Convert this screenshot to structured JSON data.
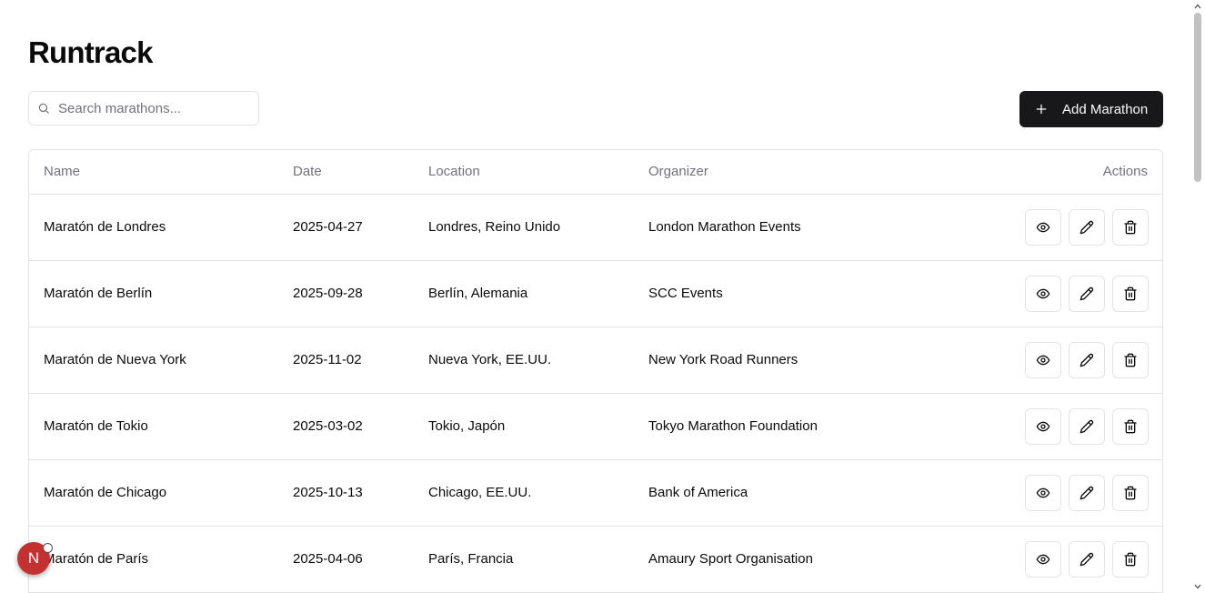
{
  "app": {
    "title": "Runtrack"
  },
  "search": {
    "placeholder": "Search marathons...",
    "value": ""
  },
  "toolbar": {
    "add_label": "Add Marathon"
  },
  "table": {
    "headers": {
      "name": "Name",
      "date": "Date",
      "location": "Location",
      "organizer": "Organizer",
      "actions": "Actions"
    },
    "rows": [
      {
        "name": "Maratón de Londres",
        "date": "2025-04-27",
        "location": "Londres, Reino Unido",
        "organizer": "London Marathon Events"
      },
      {
        "name": "Maratón de Berlín",
        "date": "2025-09-28",
        "location": "Berlín, Alemania",
        "organizer": "SCC Events"
      },
      {
        "name": "Maratón de Nueva York",
        "date": "2025-11-02",
        "location": "Nueva York, EE.UU.",
        "organizer": "New York Road Runners"
      },
      {
        "name": "Maratón de Tokio",
        "date": "2025-03-02",
        "location": "Tokio, Japón",
        "organizer": "Tokyo Marathon Foundation"
      },
      {
        "name": "Maratón de Chicago",
        "date": "2025-10-13",
        "location": "Chicago, EE.UU.",
        "organizer": "Bank of America"
      },
      {
        "name": "Maratón de París",
        "date": "2025-04-06",
        "location": "París, Francia",
        "organizer": "Amaury Sport Organisation"
      }
    ]
  },
  "icons": {
    "search": "search-icon",
    "add": "plus-icon",
    "view": "eye-icon",
    "edit": "pencil-icon",
    "delete": "trash-icon"
  },
  "dev_badge": {
    "label": "N"
  },
  "colors": {
    "primary_button": "#18181b",
    "border": "#e4e4e7",
    "muted_text": "#71717a",
    "badge": "#c53030"
  }
}
